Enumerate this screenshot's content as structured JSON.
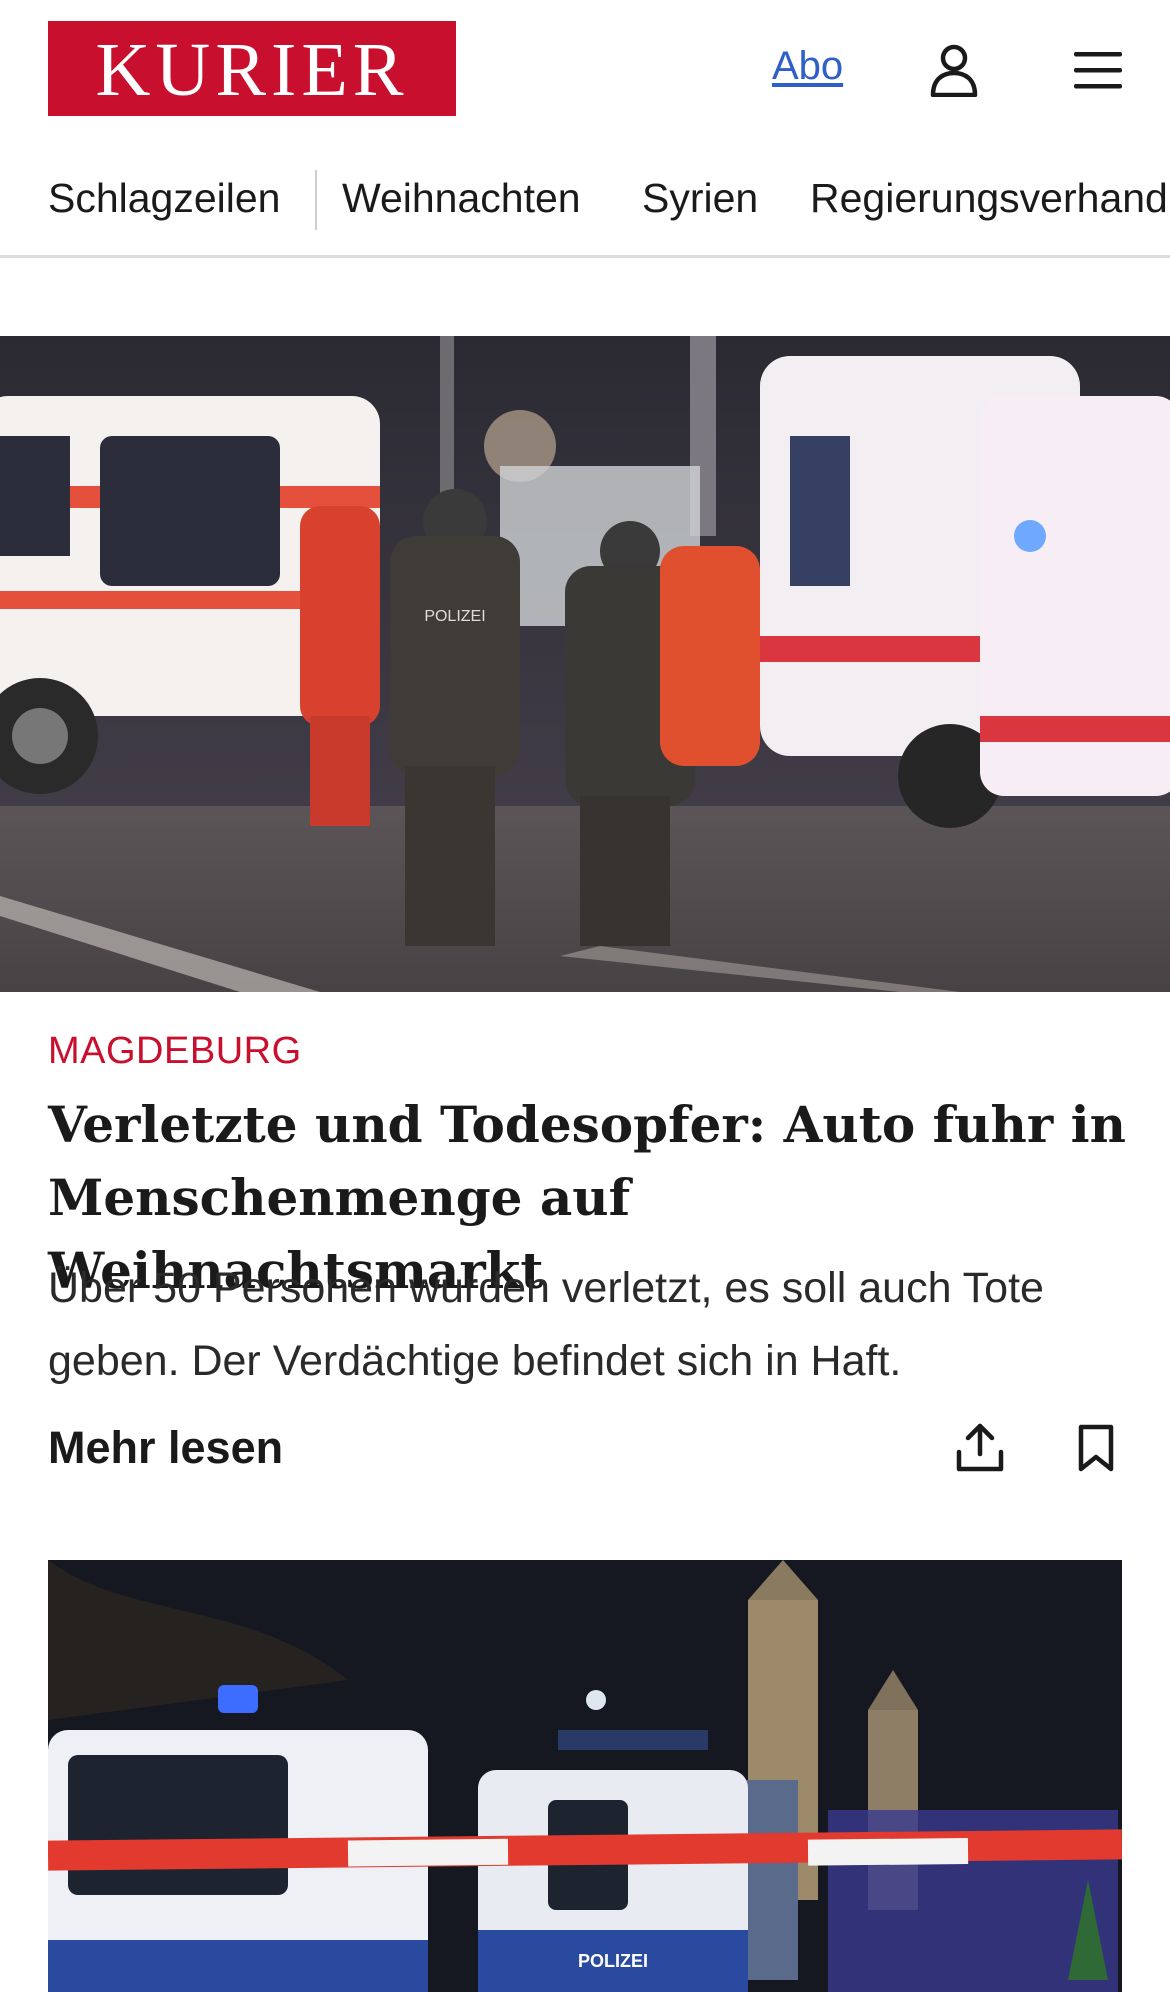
{
  "header": {
    "logo_text": "KURIER",
    "abo_label": "Abo",
    "brand_color": "#c8102e",
    "user_icon": "user-icon",
    "menu_icon": "hamburger-menu-icon"
  },
  "nav": {
    "items": [
      {
        "label": "Schlagzeilen"
      },
      {
        "label": "Weihnachten"
      },
      {
        "label": "Syrien"
      },
      {
        "label": "Regierungsverhandlungen"
      }
    ]
  },
  "article": {
    "kicker": "MAGDEBURG",
    "headline": "Verletzte und Todesopfer: Auto fuhr in Menschenmenge auf Weihnachtsmarkt",
    "teaser": "Über 50 Personen wurden verletzt, es soll auch Tote geben. Der Verdächtige befindet sich in Haft.",
    "more_label": "Mehr lesen",
    "image_label_text": "POLIZEI",
    "share_icon": "share-icon",
    "bookmark_icon": "bookmark-icon"
  },
  "second_article": {
    "image_label_text": "POLIZEI"
  }
}
